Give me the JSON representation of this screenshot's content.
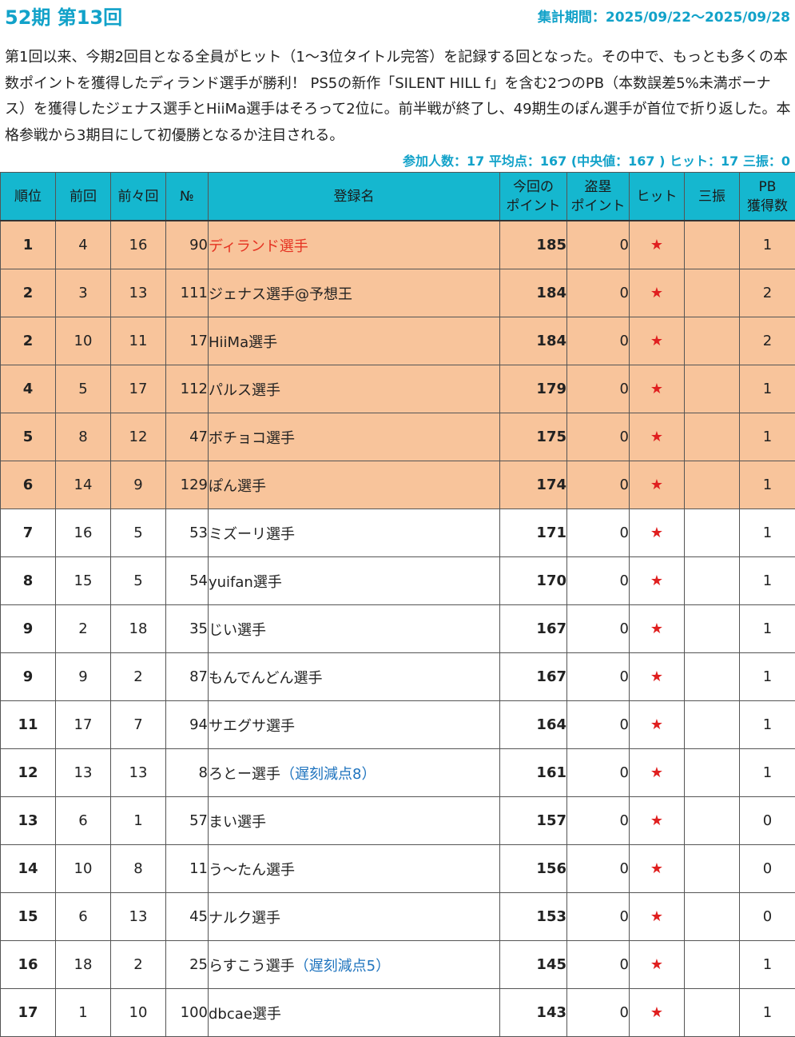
{
  "header": {
    "title": "52期 第13回",
    "period": "集計期間：2025/09/22〜2025/09/28"
  },
  "summary": "第1回以来、今期2回目となる全員がヒット（1〜3位タイトル完答）を記録する回となった。その中で、もっとも多くの本数ポイントを獲得したディランド選手が勝利！ PS5の新作「SILENT HILL f」を含む2つのPB（本数誤差5%未満ボーナス）を獲得したジェナス選手とHiiMa選手はそろって2位に。前半戦が終了し、49期生のぽん選手が首位で折り返した。本格参戦から3期目にして初優勝となるか注目される。",
  "stats": "参加人数：17 平均点：167 (中央値：167 ) ヒット：17 三振：0",
  "columns": {
    "rank": "順位",
    "prev": "前回",
    "prev2": "前々回",
    "no": "№",
    "name": "登録名",
    "points_1": "今回の",
    "points_2": "ポイント",
    "steal_1": "盗塁",
    "steal_2": "ポイント",
    "hit": "ヒット",
    "strikeout": "三振",
    "pb_1": "PB",
    "pb_2": "獲得数"
  },
  "hit_mark": "★",
  "colors": {
    "accent": "#12a2c9",
    "header_bg": "#15b7cf",
    "top_row_bg": "#f8c49b",
    "winner": "#e53322",
    "note": "#1e73be",
    "star": "#e02020"
  },
  "rows": [
    {
      "rank": "1",
      "prev": "4",
      "prev2": "16",
      "no": "90",
      "name": "ディランド選手",
      "note": "",
      "points": "185",
      "steal": "0",
      "hit": true,
      "strikeout": "",
      "pb": "1",
      "highlight": true,
      "winner": true
    },
    {
      "rank": "2",
      "prev": "3",
      "prev2": "13",
      "no": "111",
      "name": "ジェナス選手@予想王",
      "note": "",
      "points": "184",
      "steal": "0",
      "hit": true,
      "strikeout": "",
      "pb": "2",
      "highlight": true,
      "winner": false
    },
    {
      "rank": "2",
      "prev": "10",
      "prev2": "11",
      "no": "17",
      "name": "HiiMa選手",
      "note": "",
      "points": "184",
      "steal": "0",
      "hit": true,
      "strikeout": "",
      "pb": "2",
      "highlight": true,
      "winner": false
    },
    {
      "rank": "4",
      "prev": "5",
      "prev2": "17",
      "no": "112",
      "name": "パルス選手",
      "note": "",
      "points": "179",
      "steal": "0",
      "hit": true,
      "strikeout": "",
      "pb": "1",
      "highlight": true,
      "winner": false
    },
    {
      "rank": "5",
      "prev": "8",
      "prev2": "12",
      "no": "47",
      "name": "ボチョコ選手",
      "note": "",
      "points": "175",
      "steal": "0",
      "hit": true,
      "strikeout": "",
      "pb": "1",
      "highlight": true,
      "winner": false
    },
    {
      "rank": "6",
      "prev": "14",
      "prev2": "9",
      "no": "129",
      "name": "ぽん選手",
      "note": "",
      "points": "174",
      "steal": "0",
      "hit": true,
      "strikeout": "",
      "pb": "1",
      "highlight": true,
      "winner": false
    },
    {
      "rank": "7",
      "prev": "16",
      "prev2": "5",
      "no": "53",
      "name": "ミズーリ選手",
      "note": "",
      "points": "171",
      "steal": "0",
      "hit": true,
      "strikeout": "",
      "pb": "1",
      "highlight": false,
      "winner": false
    },
    {
      "rank": "8",
      "prev": "15",
      "prev2": "5",
      "no": "54",
      "name": "yuifan選手",
      "note": "",
      "points": "170",
      "steal": "0",
      "hit": true,
      "strikeout": "",
      "pb": "1",
      "highlight": false,
      "winner": false
    },
    {
      "rank": "9",
      "prev": "2",
      "prev2": "18",
      "no": "35",
      "name": "じい選手",
      "note": "",
      "points": "167",
      "steal": "0",
      "hit": true,
      "strikeout": "",
      "pb": "1",
      "highlight": false,
      "winner": false
    },
    {
      "rank": "9",
      "prev": "9",
      "prev2": "2",
      "no": "87",
      "name": "もんでんどん選手",
      "note": "",
      "points": "167",
      "steal": "0",
      "hit": true,
      "strikeout": "",
      "pb": "1",
      "highlight": false,
      "winner": false
    },
    {
      "rank": "11",
      "prev": "17",
      "prev2": "7",
      "no": "94",
      "name": "サエグサ選手",
      "note": "",
      "points": "164",
      "steal": "0",
      "hit": true,
      "strikeout": "",
      "pb": "1",
      "highlight": false,
      "winner": false
    },
    {
      "rank": "12",
      "prev": "13",
      "prev2": "13",
      "no": "8",
      "name": "ろとー選手",
      "note": "（遅刻減点8）",
      "points": "161",
      "steal": "0",
      "hit": true,
      "strikeout": "",
      "pb": "1",
      "highlight": false,
      "winner": false
    },
    {
      "rank": "13",
      "prev": "6",
      "prev2": "1",
      "no": "57",
      "name": "まい選手",
      "note": "",
      "points": "157",
      "steal": "0",
      "hit": true,
      "strikeout": "",
      "pb": "0",
      "highlight": false,
      "winner": false
    },
    {
      "rank": "14",
      "prev": "10",
      "prev2": "8",
      "no": "11",
      "name": "う〜たん選手",
      "note": "",
      "points": "156",
      "steal": "0",
      "hit": true,
      "strikeout": "",
      "pb": "0",
      "highlight": false,
      "winner": false
    },
    {
      "rank": "15",
      "prev": "6",
      "prev2": "13",
      "no": "45",
      "name": "ナルク選手",
      "note": "",
      "points": "153",
      "steal": "0",
      "hit": true,
      "strikeout": "",
      "pb": "0",
      "highlight": false,
      "winner": false
    },
    {
      "rank": "16",
      "prev": "18",
      "prev2": "2",
      "no": "25",
      "name": "らすこう選手",
      "note": "（遅刻減点5）",
      "points": "145",
      "steal": "0",
      "hit": true,
      "strikeout": "",
      "pb": "1",
      "highlight": false,
      "winner": false
    },
    {
      "rank": "17",
      "prev": "1",
      "prev2": "10",
      "no": "100",
      "name": "dbcae選手",
      "note": "",
      "points": "143",
      "steal": "0",
      "hit": true,
      "strikeout": "",
      "pb": "1",
      "highlight": false,
      "winner": false
    }
  ]
}
